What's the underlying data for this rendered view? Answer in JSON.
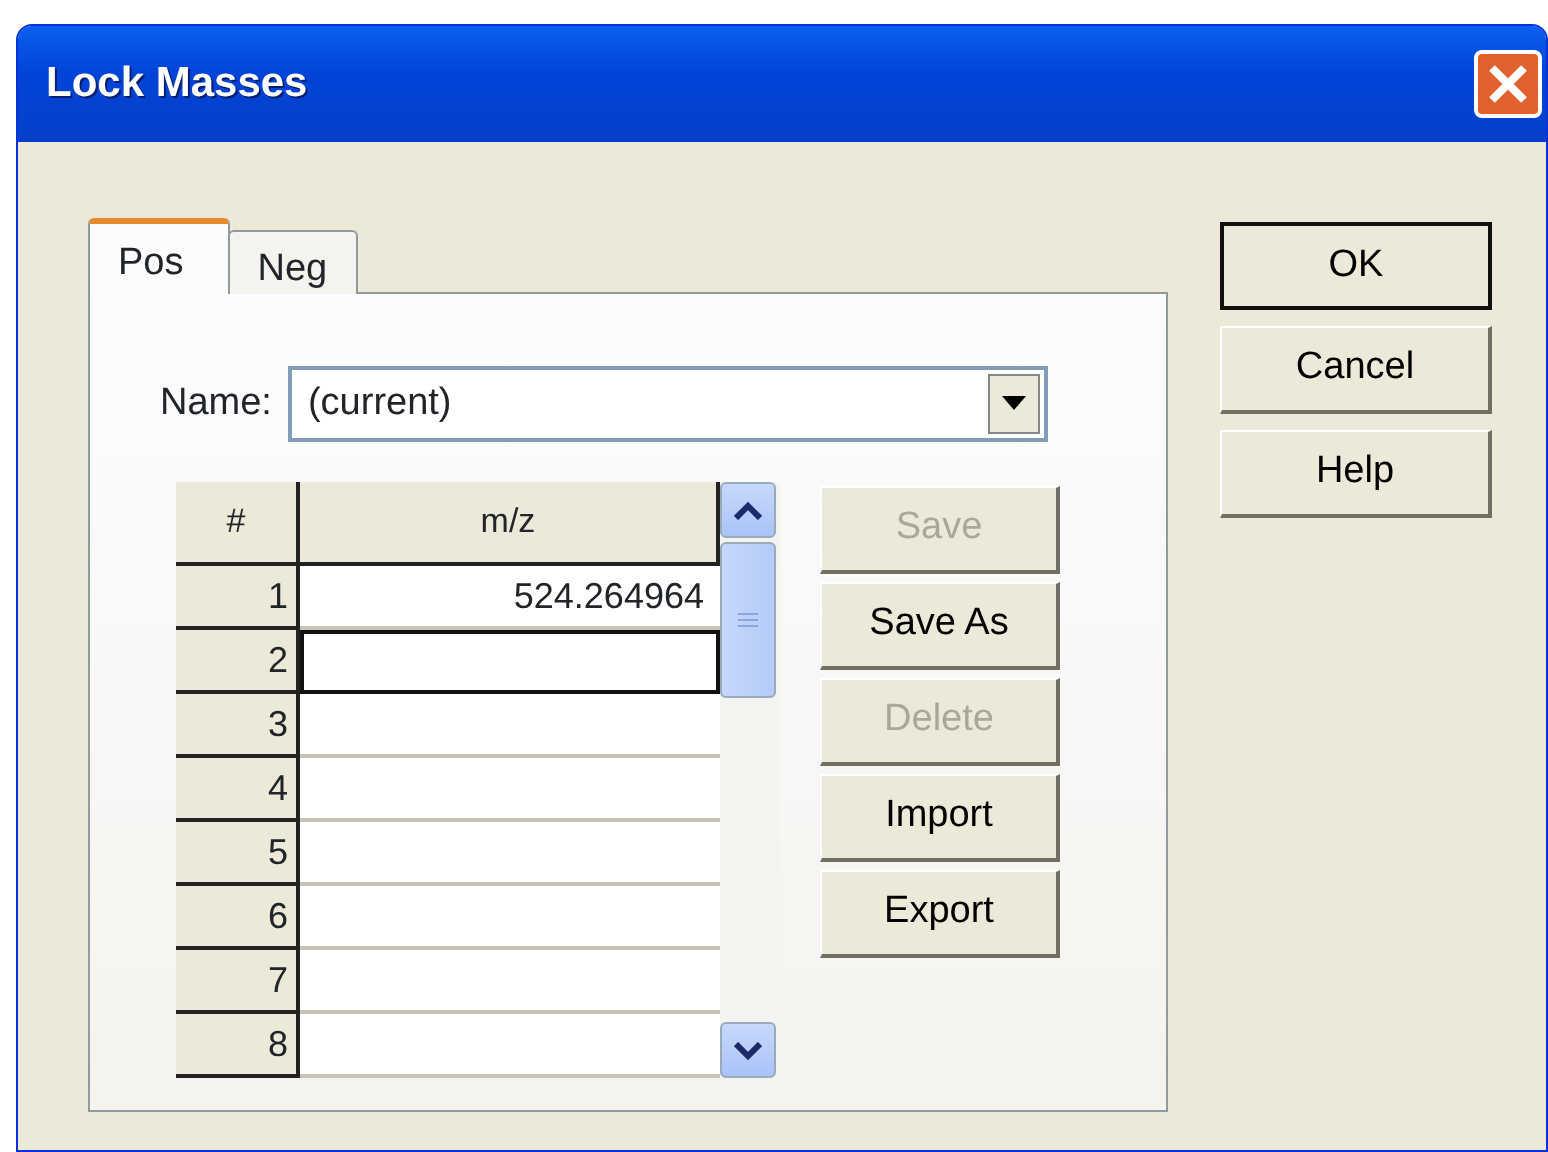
{
  "window": {
    "title": "Lock Masses"
  },
  "tabs": [
    {
      "label": "Pos",
      "selected": true
    },
    {
      "label": "Neg",
      "selected": false
    }
  ],
  "name_field": {
    "label": "Name:",
    "value": "(current)"
  },
  "table": {
    "columns": [
      "#",
      "m/z"
    ],
    "rows": [
      {
        "index": "1",
        "mz": "524.264964",
        "focused": false
      },
      {
        "index": "2",
        "mz": "",
        "focused": true
      },
      {
        "index": "3",
        "mz": "",
        "focused": false
      },
      {
        "index": "4",
        "mz": "",
        "focused": false
      },
      {
        "index": "5",
        "mz": "",
        "focused": false
      },
      {
        "index": "6",
        "mz": "",
        "focused": false
      },
      {
        "index": "7",
        "mz": "",
        "focused": false
      },
      {
        "index": "8",
        "mz": "",
        "focused": false
      }
    ]
  },
  "list_buttons": [
    {
      "label": "Save",
      "disabled": true
    },
    {
      "label": "Save As",
      "disabled": false
    },
    {
      "label": "Delete",
      "disabled": true
    },
    {
      "label": "Import",
      "disabled": false
    },
    {
      "label": "Export",
      "disabled": false
    }
  ],
  "dialog_buttons": [
    {
      "label": "OK",
      "default": true
    },
    {
      "label": "Cancel",
      "default": false
    },
    {
      "label": "Help",
      "default": false
    }
  ]
}
